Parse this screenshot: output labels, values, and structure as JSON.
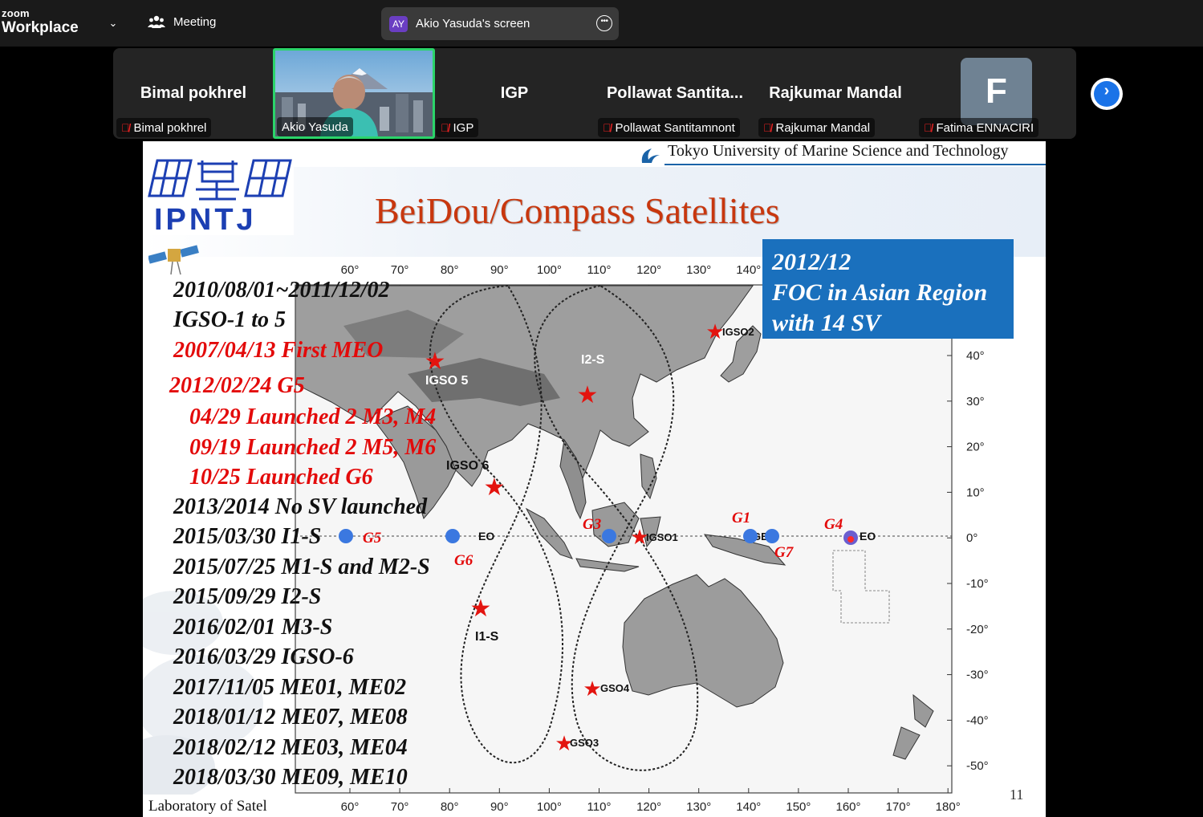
{
  "app": {
    "logo_small": "zoom",
    "logo_large": "Workplace",
    "meeting_label": "Meeting",
    "share": {
      "initials": "AY",
      "text": "Akio Yasuda's screen"
    }
  },
  "participants": [
    {
      "name_big": "Bimal pokhrel",
      "label": "Bimal pokhrel",
      "muted": true
    },
    {
      "name_big": "",
      "label": "Akio Yasuda",
      "muted": false,
      "video": true
    },
    {
      "name_big": "IGP",
      "label": "IGP",
      "muted": true
    },
    {
      "name_big": "Pollawat  Santita...",
      "label": "Pollawat Santitamnont",
      "muted": true
    },
    {
      "name_big": "Rajkumar Mandal",
      "label": "Rajkumar Mandal",
      "muted": true
    },
    {
      "name_big": "",
      "avatar_letter": "F",
      "label": "Fatima ENNACIRI",
      "muted": true
    }
  ],
  "slide": {
    "university": "Tokyo University of Marine Science and Technology",
    "logo_text": "IPNTJ",
    "title": "BeiDou/Compass Satellites",
    "foc": [
      "2012/12",
      "FOC in Asian Region",
      "with 14 SV"
    ],
    "page_number": "11",
    "footer": "Laboratory of Satel",
    "timeline": [
      {
        "text": "2010/08/01~2011/12/02",
        "color": "black"
      },
      {
        "text": "IGSO-1 to 5",
        "color": "black"
      },
      {
        "text": "2007/04/13 First MEO",
        "color": "red"
      },
      {
        "text": "2012/02/24    G5",
        "color": "red"
      },
      {
        "text": "04/29  Launched 2 M3, M4",
        "color": "red"
      },
      {
        "text": "09/19   Launched 2 M5, M6",
        "color": "red"
      },
      {
        "text": "10/25   Launched  G6",
        "color": "red"
      },
      {
        "text": "2013/2014 No SV launched",
        "color": "black"
      },
      {
        "text": "2015/03/30 I1-S",
        "color": "black"
      },
      {
        "text": "2015/07/25 M1-S and M2-S",
        "color": "black"
      },
      {
        "text": "2015/09/29 I2-S",
        "color": "black"
      },
      {
        "text": "2016/02/01 M3-S",
        "color": "black"
      },
      {
        "text": "2016/03/29 IGSO-6",
        "color": "black"
      },
      {
        "text": "2017/11/05 ME01, ME02",
        "color": "black"
      },
      {
        "text": "2018/01/12 ME07, ME08",
        "color": "black"
      },
      {
        "text": "2018/02/12 ME03, ME04",
        "color": "black"
      },
      {
        "text": "2018/03/30 ME09, ME10",
        "color": "black"
      }
    ],
    "map": {
      "lon_ticks": [
        "60°",
        "70°",
        "80°",
        "90°",
        "100°",
        "110°",
        "120°",
        "130°",
        "140°",
        "150°",
        "160°",
        "170°",
        "180°"
      ],
      "lat_ticks": [
        "40°",
        "30°",
        "20°",
        "10°",
        "0°",
        "-10°",
        "-20°",
        "-30°",
        "-40°",
        "-50°"
      ],
      "labels": {
        "igso5": "IGSO 5",
        "i2s": "I2-S",
        "igso6": "IGSO 6",
        "i1s": "I1-S",
        "igso2": "IGSO2",
        "igso1": "IGSO1",
        "gso4": "GSO4",
        "gso3": "GSO3",
        "eo": "EO",
        "ge": "GE"
      },
      "geo_sats": [
        "G5",
        "G6",
        "G3",
        "G1",
        "G7",
        "G4"
      ]
    }
  },
  "colors": {
    "accent_green": "#2bd46a",
    "title_red": "#c8370e",
    "timeline_red": "#e30a0a",
    "foc_blue": "#1a70bd",
    "next_blue": "#1a73e8"
  }
}
